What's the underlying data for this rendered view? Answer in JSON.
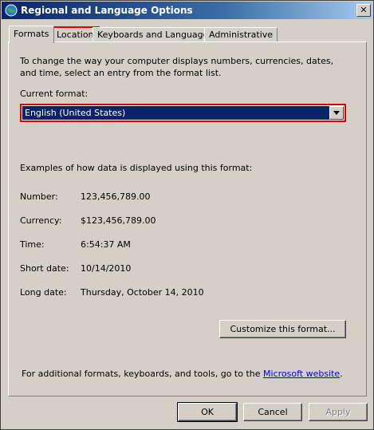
{
  "window": {
    "title": "Regional and Language Options",
    "close_label": "✕"
  },
  "tabs": [
    {
      "label": "Formats",
      "active": true
    },
    {
      "label": "Location",
      "active": false,
      "highlighted": true
    },
    {
      "label": "Keyboards and Languages",
      "active": false
    },
    {
      "label": "Administrative",
      "active": false
    }
  ],
  "formats": {
    "intro": "To change the way your computer displays numbers, currencies, dates, and time, select an entry from the format list.",
    "current_format_label": "Current format:",
    "current_format_value": "English (United States)",
    "examples_heading": "Examples of how data is displayed using this format:",
    "examples": [
      {
        "label": "Number:",
        "value": "123,456,789.00"
      },
      {
        "label": "Currency:",
        "value": "$123,456,789.00"
      },
      {
        "label": "Time:",
        "value": "6:54:37 AM"
      },
      {
        "label": "Short date:",
        "value": "10/14/2010"
      },
      {
        "label": "Long date:",
        "value": "Thursday, October 14, 2010"
      }
    ],
    "customize_label": "Customize this format...",
    "footer_text": "For additional formats, keyboards, and tools, go to the ",
    "footer_link": "Microsoft website",
    "footer_end": "."
  },
  "buttons": {
    "ok": "OK",
    "cancel": "Cancel",
    "apply": "Apply"
  },
  "colors": {
    "highlight_outline": "#e00000",
    "selection": "#0a246a",
    "link": "#0000ee"
  }
}
